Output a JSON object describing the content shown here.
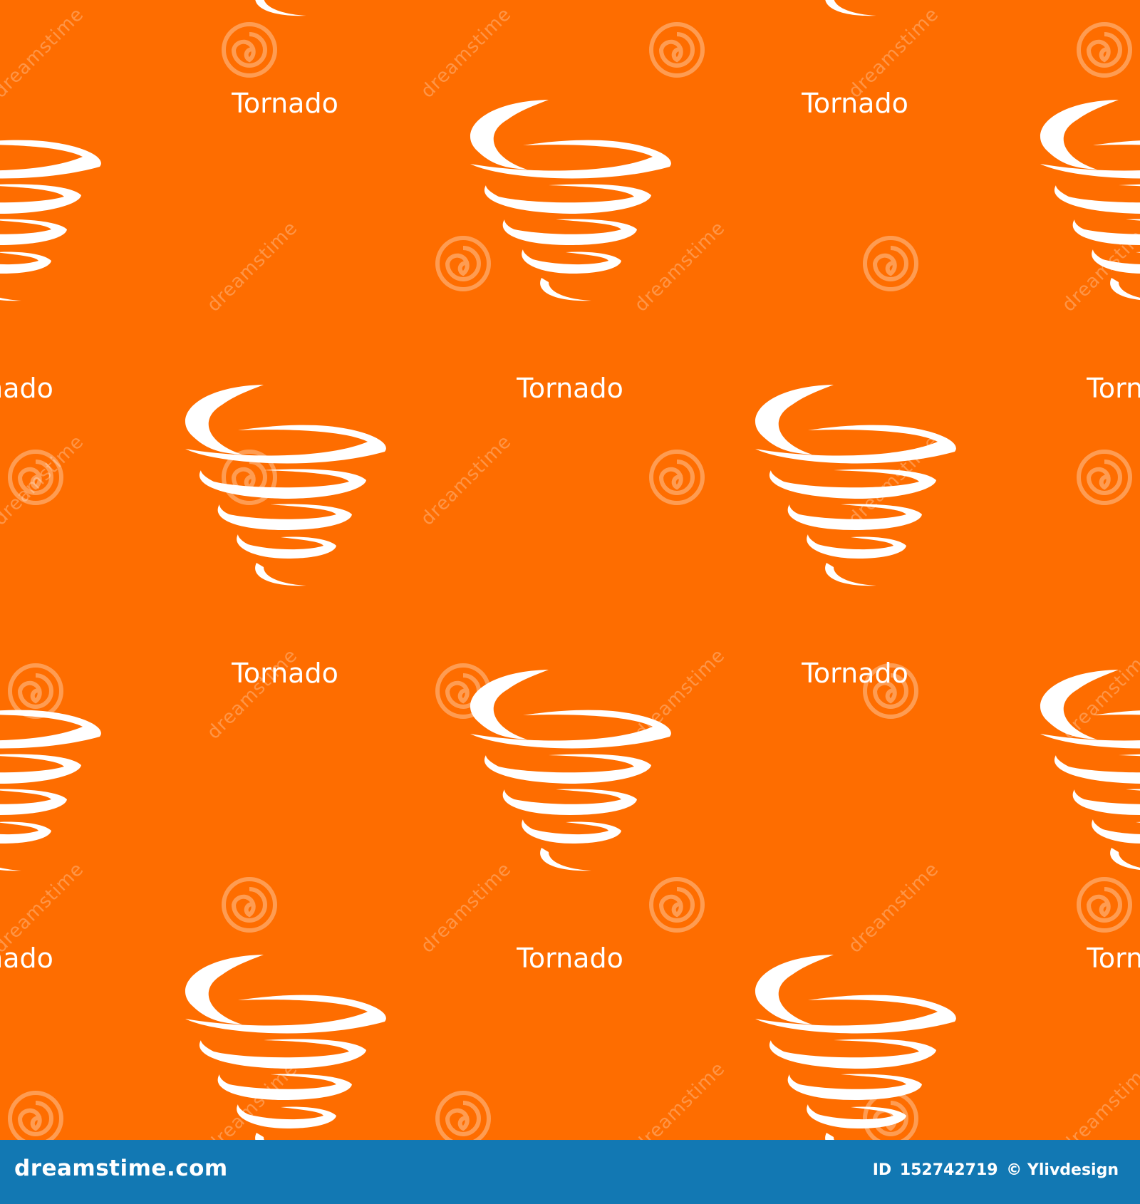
{
  "pattern": {
    "label": "Tornado",
    "background_color": "#fe6d00",
    "icon_color": "#ffffff",
    "icon": "tornado-icon",
    "watermark_text": "dreamstime",
    "watermark_icon": "dreamstime-spiral-icon"
  },
  "footer": {
    "background_color": "#1278b3",
    "site": "dreamstime.com",
    "id_label": "ID",
    "image_id": "152742719",
    "copyright": "© Ylivdesign"
  }
}
